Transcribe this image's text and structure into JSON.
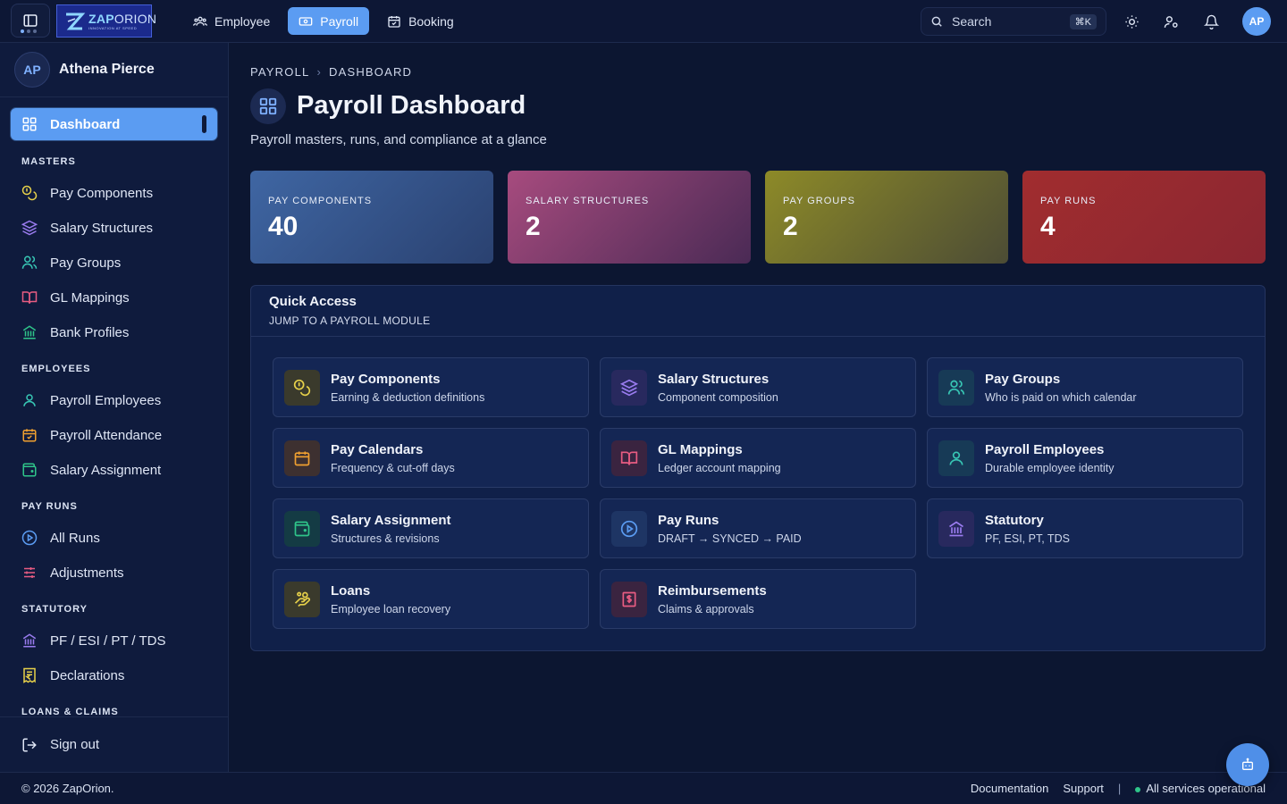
{
  "app": {
    "logo_word_1": "ZAP",
    "logo_word_2": "ORION",
    "logo_tagline": "INNOVATION AT SPEED",
    "logo_icon": "z-logo-icon"
  },
  "topnav": {
    "items": [
      {
        "label": "Employee",
        "icon": "users-icon"
      },
      {
        "label": "Payroll",
        "icon": "banknote-icon",
        "active": true
      },
      {
        "label": "Booking",
        "icon": "calendar-check-icon"
      }
    ]
  },
  "search": {
    "placeholder": "Search",
    "shortcut": "⌘K"
  },
  "user": {
    "initials": "AP",
    "name": "Athena Pierce"
  },
  "sidebar": {
    "active": {
      "label": "Dashboard",
      "icon": "layout-grid-icon"
    },
    "sections": [
      {
        "title": "MASTERS",
        "items": [
          {
            "label": "Pay Components",
            "icon": "coins-icon",
            "color": "#e7d14a"
          },
          {
            "label": "Salary Structures",
            "icon": "layers-icon",
            "color": "#9a7cf0"
          },
          {
            "label": "Pay Groups",
            "icon": "users-icon",
            "color": "#38c7b5"
          },
          {
            "label": "GL Mappings",
            "icon": "book-open-icon",
            "color": "#e85c82"
          },
          {
            "label": "Bank Profiles",
            "icon": "landmark-icon",
            "color": "#2fc58a"
          }
        ]
      },
      {
        "title": "EMPLOYEES",
        "items": [
          {
            "label": "Payroll Employees",
            "icon": "user-icon",
            "color": "#38c7b5"
          },
          {
            "label": "Payroll Attendance",
            "icon": "calendar-icon",
            "color": "#f0a030"
          },
          {
            "label": "Salary Assignment",
            "icon": "wallet-icon",
            "color": "#2fc58a"
          }
        ]
      },
      {
        "title": "PAY RUNS",
        "items": [
          {
            "label": "All Runs",
            "icon": "play-circle-icon",
            "color": "#5b9cf2"
          },
          {
            "label": "Adjustments",
            "icon": "sliders-icon",
            "color": "#e85c82"
          }
        ]
      },
      {
        "title": "STATUTORY",
        "items": [
          {
            "label": "PF / ESI / PT / TDS",
            "icon": "landmark-icon",
            "color": "#9a7cf0"
          },
          {
            "label": "Declarations",
            "icon": "receipt-rupee-icon",
            "color": "#e7d14a"
          }
        ]
      },
      {
        "title": "LOANS & CLAIMS",
        "items": []
      }
    ],
    "signout": "Sign out"
  },
  "breadcrumb": [
    "PAYROLL",
    "DASHBOARD"
  ],
  "page": {
    "title": "Payroll Dashboard",
    "subtitle": "Payroll masters, runs, and compliance at a glance"
  },
  "stats": [
    {
      "label": "PAY COMPONENTS",
      "value": "40"
    },
    {
      "label": "SALARY STRUCTURES",
      "value": "2"
    },
    {
      "label": "PAY GROUPS",
      "value": "2"
    },
    {
      "label": "PAY RUNS",
      "value": "4"
    }
  ],
  "quick_access": {
    "title": "Quick Access",
    "subtitle": "JUMP TO A PAYROLL MODULE",
    "cards": [
      {
        "title": "Pay Components",
        "desc": "Earning & deduction definitions",
        "icon": "coins-icon",
        "color": "#e7d14a"
      },
      {
        "title": "Salary Structures",
        "desc": "Component composition",
        "icon": "layers-icon",
        "color": "#9a7cf0"
      },
      {
        "title": "Pay Groups",
        "desc": "Who is paid on which calendar",
        "icon": "users-icon",
        "color": "#38c7b5"
      },
      {
        "title": "Pay Calendars",
        "desc": "Frequency & cut-off days",
        "icon": "calendar-icon",
        "color": "#f0a030"
      },
      {
        "title": "GL Mappings",
        "desc": "Ledger account mapping",
        "icon": "book-open-icon",
        "color": "#e85c82"
      },
      {
        "title": "Payroll Employees",
        "desc": "Durable employee identity",
        "icon": "user-icon",
        "color": "#38c7b5"
      },
      {
        "title": "Salary Assignment",
        "desc": "Structures & revisions",
        "icon": "wallet-icon",
        "color": "#2fc58a"
      },
      {
        "title": "Pay Runs",
        "desc": "DRAFT → SYNCED → PAID",
        "icon": "play-circle-icon",
        "color": "#5b9cf2"
      },
      {
        "title": "Statutory",
        "desc": "PF, ESI, PT, TDS",
        "icon": "landmark-icon",
        "color": "#9a7cf0"
      },
      {
        "title": "Loans",
        "desc": "Employee loan recovery",
        "icon": "hand-coins-icon",
        "color": "#e7d14a"
      },
      {
        "title": "Reimbursements",
        "desc": "Claims & approvals",
        "icon": "receipt-dollar-icon",
        "color": "#e85c82"
      }
    ]
  },
  "footer": {
    "copyright": "© 2026 ZapOrion.",
    "links": [
      "Documentation",
      "Support"
    ],
    "status": "All services operational"
  }
}
